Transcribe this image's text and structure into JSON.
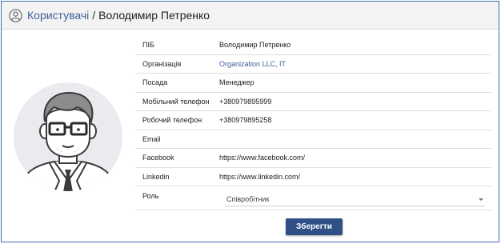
{
  "header": {
    "breadcrumb_link": "Користувачі",
    "separator": "/",
    "current": "Володимир Петренко"
  },
  "form": {
    "rows": [
      {
        "label": "ПІБ",
        "value": "Володимир Петренко"
      },
      {
        "label": "Організація",
        "value": "Organization LLC, IT"
      },
      {
        "label": "Посада",
        "value": "Менеджер"
      },
      {
        "label": "Мобільний телефон",
        "value": "+380979895999"
      },
      {
        "label": "Робочий телефон",
        "value": "+380979895258"
      },
      {
        "label": "Email",
        "value": ""
      },
      {
        "label": "Facebook",
        "value": "https://www.facebook.com/"
      },
      {
        "label": "Linkedin",
        "value": "https://www.linkedin.com/"
      }
    ],
    "role": {
      "label": "Роль",
      "selected": "Співробітник"
    }
  },
  "save_button": "Зберегти",
  "colors": {
    "accent": "#3e5f98",
    "button": "#2f4f86",
    "frame_border": "#3b6fb0"
  },
  "icons": {
    "header_icon": "user-outline-icon",
    "role_caret": "chevron-down-icon"
  }
}
